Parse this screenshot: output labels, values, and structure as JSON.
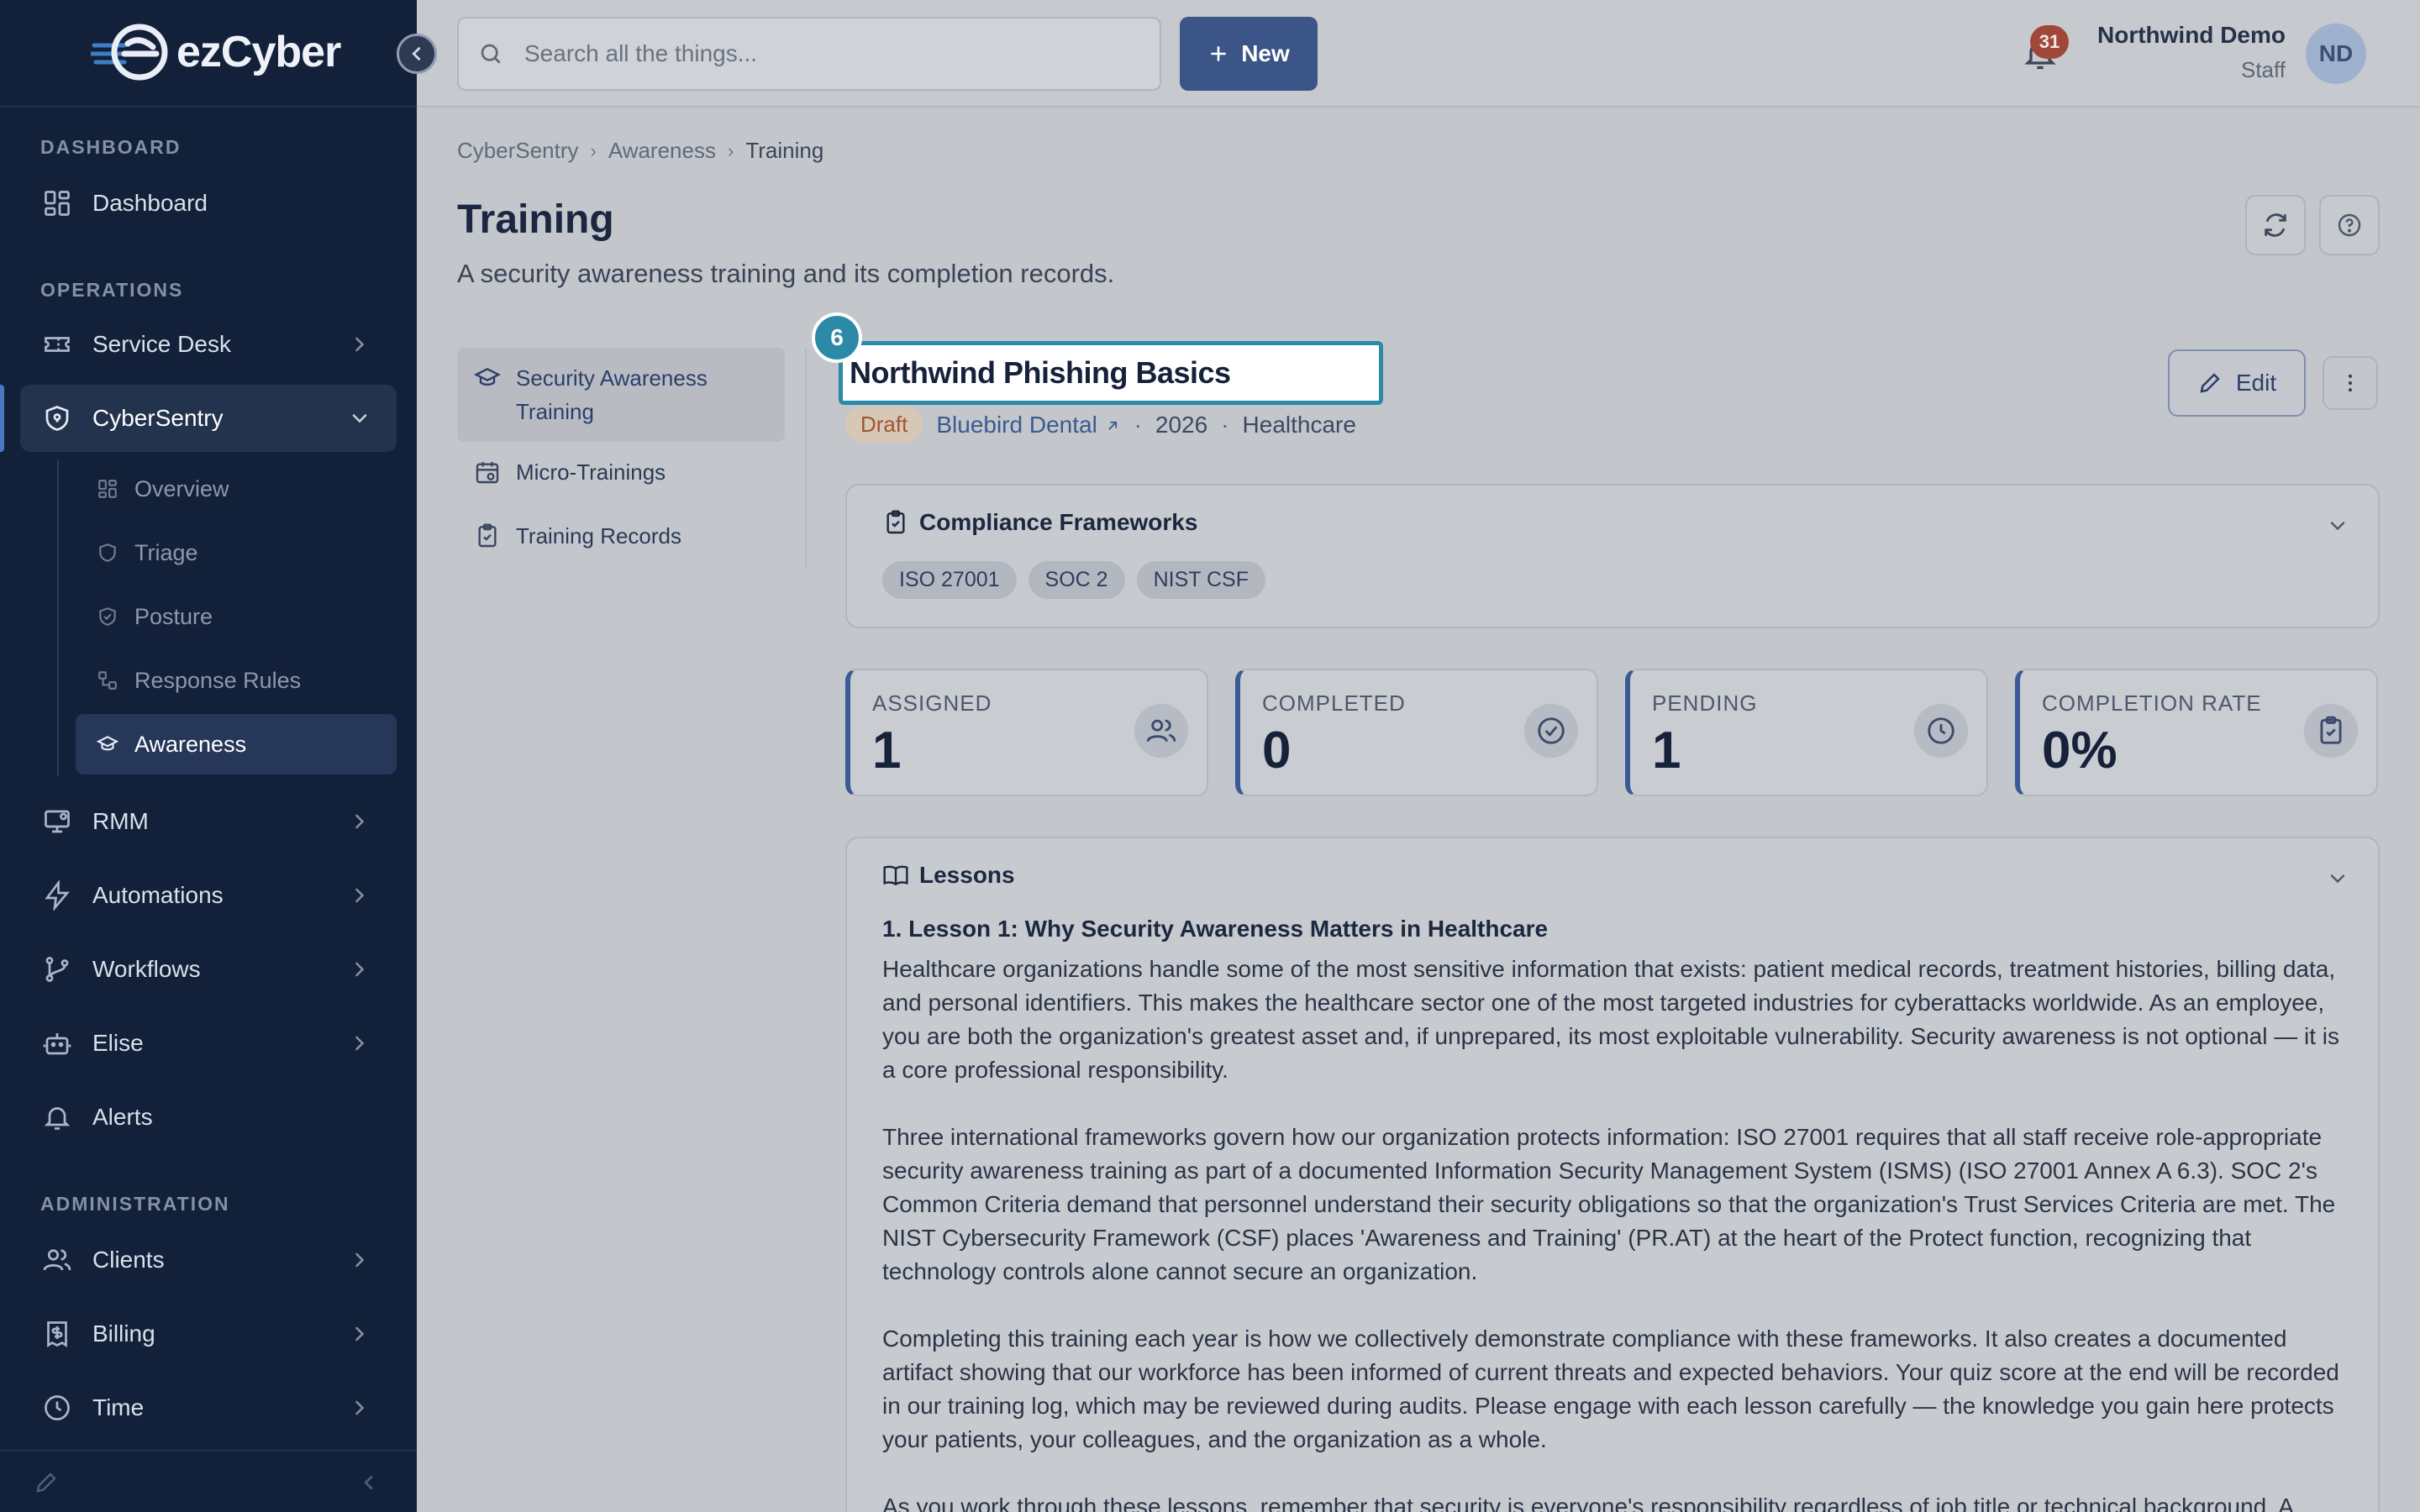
{
  "app": {
    "logo_text": "ezCyber"
  },
  "sidebar": {
    "sections": {
      "dashboard": "DASHBOARD",
      "operations": "OPERATIONS",
      "administration": "ADMINISTRATION"
    },
    "items": {
      "dashboard": "Dashboard",
      "service_desk": "Service Desk",
      "cybersentry": "CyberSentry",
      "rmm": "RMM",
      "automations": "Automations",
      "workflows": "Workflows",
      "elise": "Elise",
      "alerts": "Alerts",
      "clients": "Clients",
      "billing": "Billing",
      "time": "Time"
    },
    "cybersentry_sub": {
      "overview": "Overview",
      "triage": "Triage",
      "posture": "Posture",
      "response_rules": "Response Rules",
      "awareness": "Awareness"
    }
  },
  "topbar": {
    "search_placeholder": "Search all the things...",
    "new_label": "New",
    "notification_count": "31",
    "user_name": "Northwind Demo",
    "user_role": "Staff",
    "avatar_initials": "ND"
  },
  "breadcrumb": [
    "CyberSentry",
    "Awareness",
    "Training"
  ],
  "page": {
    "title": "Training",
    "subtitle": "A security awareness training and its completion records."
  },
  "tabs": {
    "security_awareness": "Security Awareness Training",
    "micro_trainings": "Micro-Trainings",
    "training_records": "Training Records"
  },
  "training": {
    "marker": "6",
    "title": "Northwind Phishing Basics",
    "status": "Draft",
    "client": "Bluebird Dental",
    "year": "2026",
    "industry": "Healthcare",
    "edit_label": "Edit"
  },
  "compliance": {
    "title": "Compliance Frameworks",
    "frameworks": [
      "ISO 27001",
      "SOC 2",
      "NIST CSF"
    ]
  },
  "stats": [
    {
      "label": "ASSIGNED",
      "value": "1"
    },
    {
      "label": "COMPLETED",
      "value": "0"
    },
    {
      "label": "PENDING",
      "value": "1"
    },
    {
      "label": "COMPLETION RATE",
      "value": "0%"
    }
  ],
  "lessons": {
    "title": "Lessons",
    "lesson_title": "1. Lesson 1: Why Security Awareness Matters in Healthcare",
    "paragraphs": [
      "Healthcare organizations handle some of the most sensitive information that exists: patient medical records, treatment histories, billing data, and personal identifiers. This makes the healthcare sector one of the most targeted industries for cyberattacks worldwide. As an employee, you are both the organization's greatest asset and, if unprepared, its most exploitable vulnerability. Security awareness is not optional — it is a core professional responsibility.",
      "Three international frameworks govern how our organization protects information: ISO 27001 requires that all staff receive role-appropriate security awareness training as part of a documented Information Security Management System (ISMS) (ISO 27001 Annex A 6.3). SOC 2's Common Criteria demand that personnel understand their security obligations so that the organization's Trust Services Criteria are met. The NIST Cybersecurity Framework (CSF) places 'Awareness and Training' (PR.AT) at the heart of the Protect function, recognizing that technology controls alone cannot secure an organization.",
      "Completing this training each year is how we collectively demonstrate compliance with these frameworks. It also creates a documented artifact showing that our workforce has been informed of current threats and expected behaviors. Your quiz score at the end will be recorded in our training log, which may be reviewed during audits. Please engage with each lesson carefully — the knowledge you gain here protects your patients, your colleagues, and the organization as a whole.",
      "As you work through these lessons, remember that security is everyone's responsibility regardless of job title or technical background. A"
    ]
  },
  "colors": {
    "sidebar_bg": "#13203a",
    "accent": "#3b5588",
    "highlight": "#2a8aa8",
    "badge": "#a0473a"
  }
}
